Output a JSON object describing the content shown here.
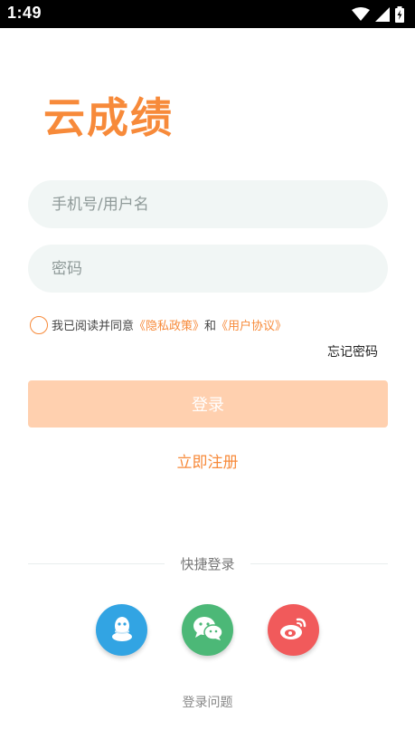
{
  "status_bar": {
    "time": "1:49",
    "icons": [
      "wifi-icon",
      "signal-icon",
      "battery-charging-icon"
    ]
  },
  "app": {
    "logo_text": "云成绩",
    "brand_color": "#f78a3a"
  },
  "form": {
    "phone_placeholder": "手机号/用户名",
    "phone_value": "",
    "password_placeholder": "密码",
    "password_value": ""
  },
  "agreement": {
    "checked": false,
    "prefix": "我已阅读并同意",
    "privacy_link": "《隐私政策》",
    "conjunction": "和",
    "user_agreement_link": "《用户协议》"
  },
  "forgot_password": "忘记密码",
  "login_button": "登录",
  "register_link": "立即注册",
  "quick_login": {
    "title": "快捷登录",
    "options": [
      {
        "name": "qq",
        "icon": "qq-icon",
        "color": "#32a4e3"
      },
      {
        "name": "wechat",
        "icon": "wechat-icon",
        "color": "#4cb877"
      },
      {
        "name": "weibo",
        "icon": "weibo-icon",
        "color": "#f15a5b"
      }
    ]
  },
  "login_issue": "登录问题"
}
